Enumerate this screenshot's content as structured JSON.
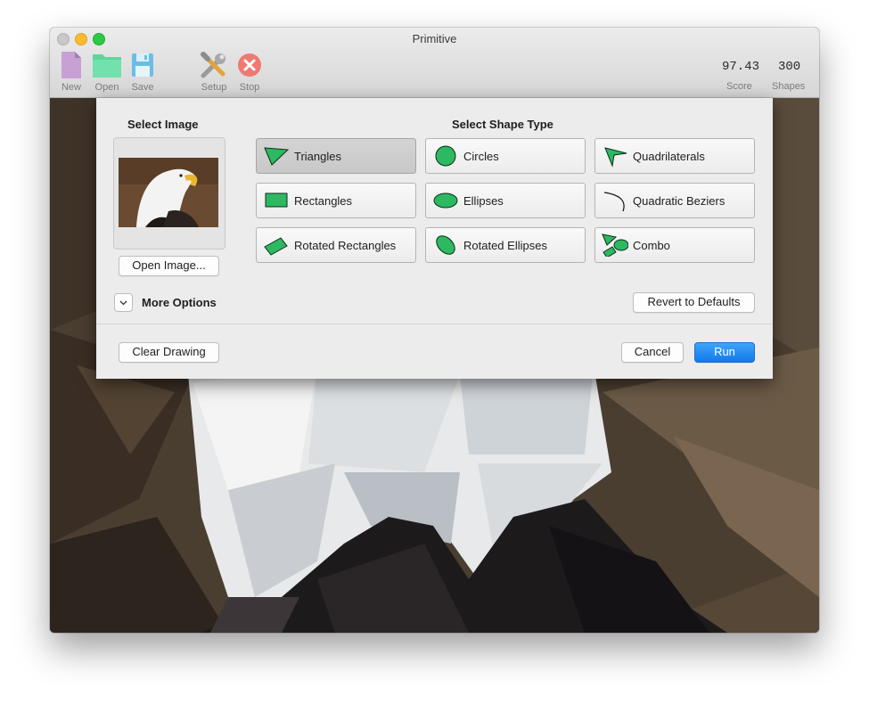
{
  "window": {
    "title": "Primitive"
  },
  "toolbar": {
    "new_label": "New",
    "open_label": "Open",
    "save_label": "Save",
    "setup_label": "Setup",
    "stop_label": "Stop"
  },
  "stats": {
    "score_value": "97.43",
    "score_label": "Score",
    "shapes_value": "300",
    "shapes_label": "Shapes"
  },
  "dialog": {
    "select_image_heading": "Select Image",
    "open_image_label": "Open Image...",
    "select_shape_heading": "Select Shape Type",
    "shape_types": [
      {
        "label": "Triangles",
        "icon": "triangle-icon",
        "selected": true
      },
      {
        "label": "Circles",
        "icon": "circle-icon",
        "selected": false
      },
      {
        "label": "Quadrilaterals",
        "icon": "quadrilateral-icon",
        "selected": false
      },
      {
        "label": "Rectangles",
        "icon": "rectangle-icon",
        "selected": false
      },
      {
        "label": "Ellipses",
        "icon": "ellipse-icon",
        "selected": false
      },
      {
        "label": "Quadratic Beziers",
        "icon": "bezier-curve-icon",
        "selected": false
      },
      {
        "label": "Rotated Rectangles",
        "icon": "rotated-rectangle-icon",
        "selected": false
      },
      {
        "label": "Rotated Ellipses",
        "icon": "rotated-ellipse-icon",
        "selected": false
      },
      {
        "label": "Combo",
        "icon": "combo-shapes-icon",
        "selected": false
      }
    ],
    "more_options_label": "More Options",
    "revert_label": "Revert to Defaults",
    "clear_label": "Clear Drawing",
    "cancel_label": "Cancel",
    "run_label": "Run"
  },
  "colors": {
    "shape_green": "#2db862",
    "run_blue": "#1a84f1",
    "stop_red": "#ef7a72",
    "new_purple": "#c7a0d4",
    "open_green": "#5fd59c",
    "save_blue": "#6bbde8"
  }
}
